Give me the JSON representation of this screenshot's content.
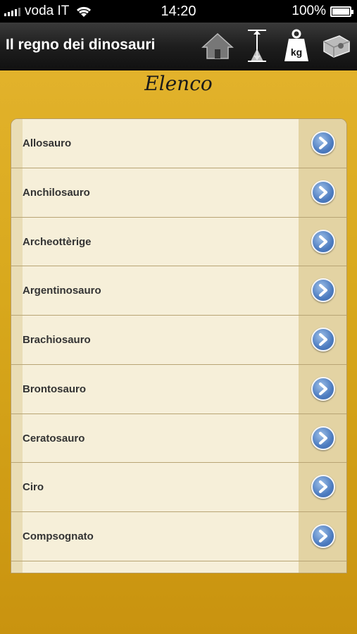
{
  "status_bar": {
    "carrier": "voda IT",
    "time": "14:20",
    "battery": "100%"
  },
  "nav": {
    "title": "Il regno dei dinosauri",
    "icons": [
      "home-icon",
      "height-icon",
      "weight-icon",
      "tape-measure-icon"
    ],
    "weight_label": "kg"
  },
  "heading": "Elenco",
  "list": {
    "items": [
      {
        "label": "Allosauro"
      },
      {
        "label": "Anchilosauro"
      },
      {
        "label": "Archeottèrige"
      },
      {
        "label": "Argentinosauro"
      },
      {
        "label": "Brachiosauro"
      },
      {
        "label": "Brontosauro"
      },
      {
        "label": "Ceratosauro"
      },
      {
        "label": "Ciro"
      },
      {
        "label": "Compsognato"
      },
      {
        "label": ""
      }
    ]
  },
  "colors": {
    "background": "#d8a81c",
    "list_bg": "#f6efd9",
    "chevron": "#4d7cc0"
  }
}
